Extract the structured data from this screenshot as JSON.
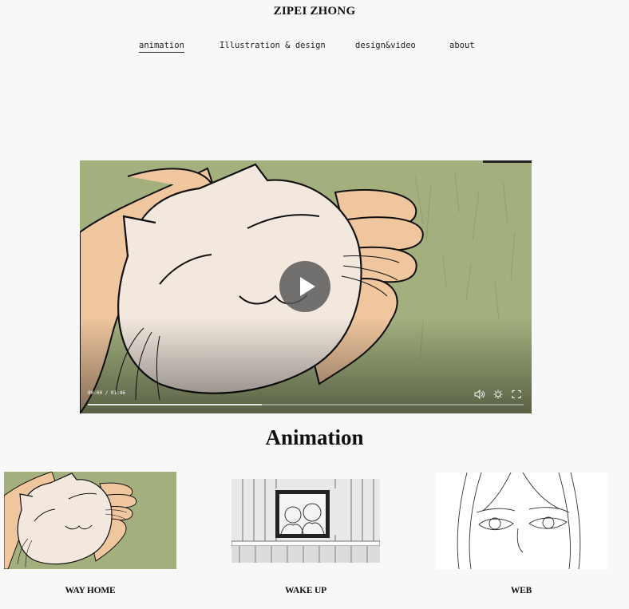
{
  "site": {
    "title": "ZIPEI ZHONG"
  },
  "nav": {
    "items": [
      {
        "label": "animation",
        "active": true
      },
      {
        "label": "Illustration & design",
        "active": false
      },
      {
        "label": "design&video",
        "active": false
      },
      {
        "label": "about",
        "active": false
      }
    ]
  },
  "video": {
    "time": "00:00 / 01:46",
    "buffered_fraction": 0.4,
    "controls": [
      "volume-icon",
      "settings-icon",
      "fullscreen-icon"
    ],
    "play_icon": "play-icon"
  },
  "section": {
    "title": "Animation"
  },
  "cards": [
    {
      "label": "WAY HOME"
    },
    {
      "label": "WAKE UP"
    },
    {
      "label": "WEB"
    }
  ],
  "colors": {
    "background": "#f8f8f8",
    "grass": "#a3b07e",
    "hand": "#efc69e",
    "cat": "#f2e8de"
  }
}
